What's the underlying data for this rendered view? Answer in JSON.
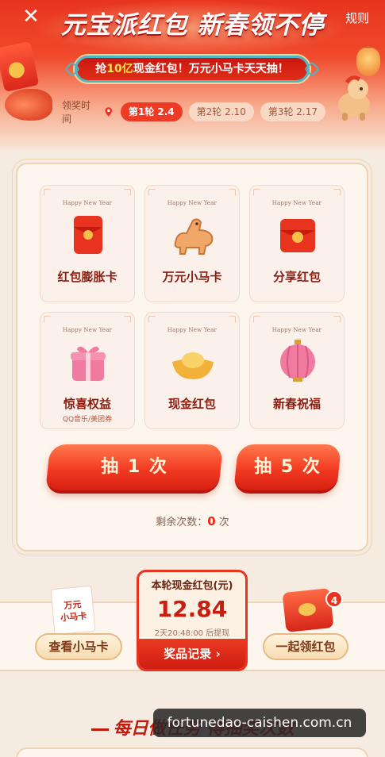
{
  "header": {
    "close_icon": "close-icon",
    "title": "元宝派红包 新春领不停",
    "rules_label": "规则",
    "banner": {
      "prefix": "抢",
      "highlight": "10亿",
      "suffix": "现金红包！万元小马卡天天抽！"
    },
    "award_time_label": "领奖时间",
    "rounds": [
      {
        "label": "第1轮 2.4",
        "active": true
      },
      {
        "label": "第2轮 2.10",
        "active": false
      },
      {
        "label": "第3轮 2.17",
        "active": false
      }
    ]
  },
  "prizes": [
    {
      "header": "Happy New Year",
      "label": "红包膨胀卡",
      "sub": "",
      "icon": "red-envelope-icon"
    },
    {
      "header": "Happy New Year",
      "label": "万元小马卡",
      "sub": "",
      "icon": "horse-cookie-icon"
    },
    {
      "header": "Happy New Year",
      "label": "分享红包",
      "sub": "",
      "icon": "share-envelope-icon"
    },
    {
      "header": "Happy New Year",
      "label": "惊喜权益",
      "sub": "QQ音乐/美团券",
      "icon": "gift-box-icon"
    },
    {
      "header": "Happy New Year",
      "label": "现金红包",
      "sub": "",
      "icon": "gold-ingot-icon"
    },
    {
      "header": "Happy New Year",
      "label": "新春祝福",
      "sub": "",
      "icon": "lantern-icon"
    }
  ],
  "draw": {
    "once_label": "抽 1 次",
    "five_label": "抽 5 次",
    "remaining_label": "剩余次数：",
    "remaining_count": "0",
    "remaining_unit": "次"
  },
  "bottom": {
    "card_thumb_line1": "万元",
    "card_thumb_line2": "小马卡",
    "view_cards_label": "查看小马卡",
    "cash_title": "本轮现金红包(元)",
    "cash_amount": "12.84",
    "countdown": "2天20:48:00 后提现",
    "records_label": "奖品记录 ›",
    "collect_label": "一起领红包",
    "collect_badge": "4"
  },
  "daily_tasks_title": "每日做任务 得抽奖次数",
  "watermark": "fortunedao-caishen.com.cn",
  "colors": {
    "primary_red": "#e8341f",
    "gold": "#f7d59a",
    "teal_accent": "#4bb6c5",
    "cream": "#fdf6ee"
  }
}
